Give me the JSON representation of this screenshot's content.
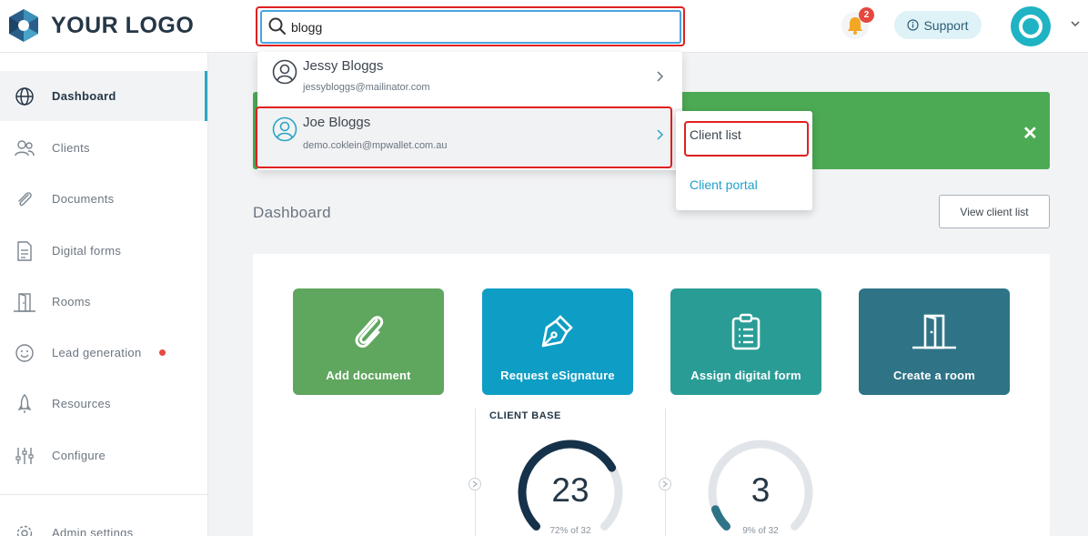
{
  "logo": {
    "text": "YOUR LOGO"
  },
  "search": {
    "value": "blogg",
    "placeholder": ""
  },
  "header": {
    "notification_count": "2",
    "support_label": "Support"
  },
  "sidebar": {
    "items": [
      {
        "label": "Dashboard",
        "icon": "globe-icon",
        "active": true
      },
      {
        "label": "Clients",
        "icon": "users-icon"
      },
      {
        "label": "Documents",
        "icon": "paperclip-icon"
      },
      {
        "label": "Digital forms",
        "icon": "document-icon"
      },
      {
        "label": "Rooms",
        "icon": "door-icon"
      },
      {
        "label": "Lead generation",
        "icon": "smiley-icon",
        "has_dot": true
      },
      {
        "label": "Resources",
        "icon": "rocket-icon"
      },
      {
        "label": "Configure",
        "icon": "sliders-icon"
      },
      {
        "label": "Admin settings",
        "icon": "gear-icon"
      }
    ]
  },
  "dropdown": {
    "results": [
      {
        "name": "Jessy Bloggs",
        "email": "jessybloggs@mailinator.com"
      },
      {
        "name": "Joe Bloggs",
        "email": "demo.coklein@mpwallet.com.au"
      }
    ],
    "submenu": [
      {
        "label": "Client list"
      },
      {
        "label": "Client portal"
      }
    ]
  },
  "main": {
    "title": "Dashboard",
    "view_client_list": "View client list",
    "tiles": [
      {
        "label": "Add document",
        "color": "#5fa65e",
        "icon": "paperclip-icon"
      },
      {
        "label": "Request eSignature",
        "color": "#0e9dc4",
        "icon": "pen-nib-icon"
      },
      {
        "label": "Assign digital form",
        "color": "#2a9c96",
        "icon": "clipboard-icon"
      },
      {
        "label": "Create a room",
        "color": "#2f7387",
        "icon": "door-icon"
      }
    ],
    "client_base_label": "CLIENT BASE",
    "gauges": [
      {
        "value": "23",
        "caption": "72% of 32",
        "fraction": 0.72,
        "color": "#16324a"
      },
      {
        "value": "3",
        "caption": "9% of 32",
        "fraction": 0.09,
        "color": "#2f7387"
      }
    ]
  },
  "colors": {
    "accent": "#2aa6c4",
    "banner": "#4caa54",
    "highlight": "#e02020"
  }
}
